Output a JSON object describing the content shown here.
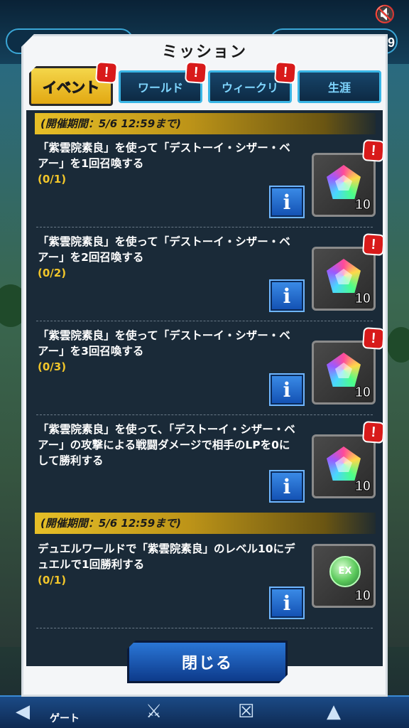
{
  "background": {
    "status_number": "9",
    "bottom_nav_label": "ゲート"
  },
  "dialog": {
    "title": "ミッション",
    "tabs": [
      {
        "label": "イベント",
        "active": true,
        "alert": true
      },
      {
        "label": "ワールド",
        "active": false,
        "alert": true
      },
      {
        "label": "ウィークリ",
        "active": false,
        "alert": true
      },
      {
        "label": "生涯",
        "active": false,
        "alert": false
      }
    ],
    "alert_symbol": "!",
    "info_symbol": "i",
    "sections": [
      {
        "period": "(開催期間：5/6 12:59まで)",
        "missions": [
          {
            "desc": "「紫雲院素良」を使って「デストーイ・シザー・ベアー」を1回召喚する",
            "progress": "(0/1)",
            "reward_icon": "crystal-gem-icon",
            "reward_count": "10",
            "alert": true
          },
          {
            "desc": "「紫雲院素良」を使って「デストーイ・シザー・ベアー」を2回召喚する",
            "progress": "(0/2)",
            "reward_icon": "crystal-gem-icon",
            "reward_count": "10",
            "alert": true
          },
          {
            "desc": "「紫雲院素良」を使って「デストーイ・シザー・ベアー」を3回召喚する",
            "progress": "(0/3)",
            "reward_icon": "crystal-gem-icon",
            "reward_count": "10",
            "alert": true
          },
          {
            "desc": "「紫雲院素良」を使って、「デストーイ・シザー・ベアー」の攻撃による戦闘ダメージで相手のLPを0にして勝利する",
            "progress": "",
            "reward_icon": "crystal-gem-icon",
            "reward_count": "10",
            "alert": true
          }
        ]
      },
      {
        "period": "(開催期間：5/6 12:59まで)",
        "missions": [
          {
            "desc": "デュエルワールドで「紫雲院素良」のレベル10にデュエルで1回勝利する",
            "progress": "(0/1)",
            "reward_icon": "ex-orb-icon",
            "reward_label": "EX",
            "reward_count": "10",
            "alert": false
          }
        ]
      }
    ],
    "close_label": "閉じる"
  }
}
